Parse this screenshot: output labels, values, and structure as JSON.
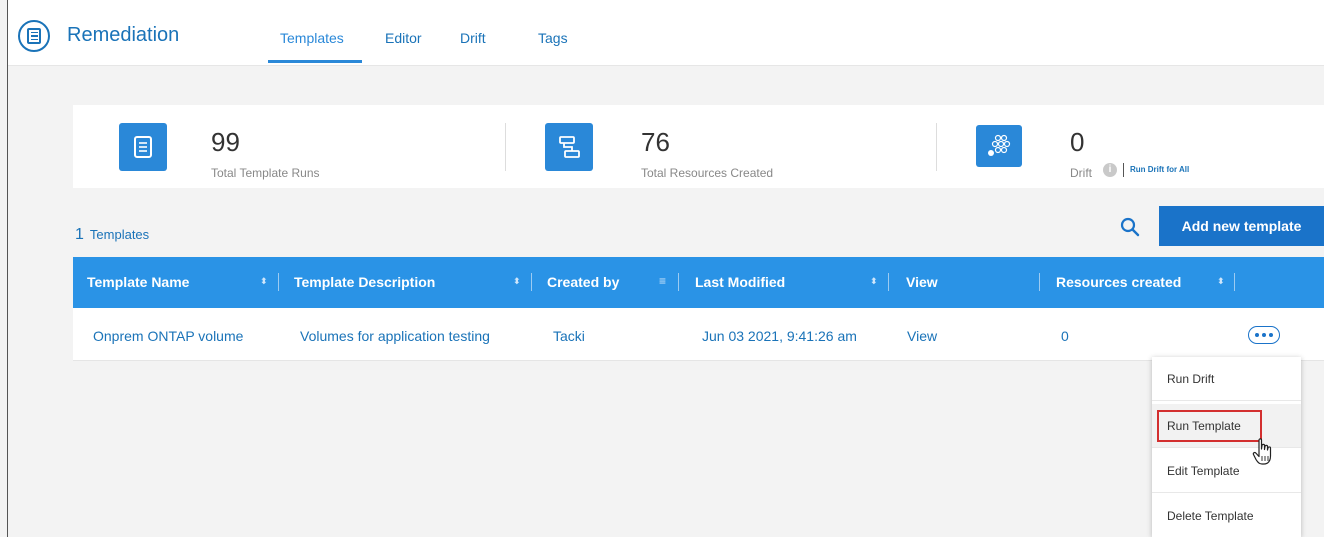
{
  "header": {
    "app_title": "Remediation",
    "tabs": [
      {
        "label": "Templates",
        "active": true
      },
      {
        "label": "Editor",
        "active": false
      },
      {
        "label": "Drift",
        "active": false
      },
      {
        "label": "Tags",
        "active": false
      }
    ],
    "app_icon": "document-circle-icon"
  },
  "stats": {
    "runs": {
      "value": "99",
      "label": "Total Template Runs",
      "icon": "document-icon"
    },
    "resources": {
      "value": "76",
      "label": "Total Resources Created",
      "icon": "hierarchy-icon"
    },
    "drift": {
      "value": "0",
      "label": "Drift",
      "icon": "dots-cluster-icon",
      "info_icon": "info-icon",
      "link": "Run Drift for All"
    }
  },
  "templates": {
    "count": "1",
    "label": "Templates",
    "add_button": "Add new template",
    "search_icon": "search-icon"
  },
  "table": {
    "columns": [
      "Template Name",
      "Template Description",
      "Created by",
      "Last Modified",
      "View",
      "Resources created"
    ],
    "rows": [
      {
        "name": "Onprem ONTAP volume",
        "description": "Volumes for application testing",
        "created_by": "Tacki",
        "last_modified": "Jun 03 2021, 9:41:26 am",
        "view": "View",
        "resources": "0"
      }
    ]
  },
  "menu": {
    "items": [
      "Run Drift",
      "Run Template",
      "Edit Template",
      "Delete Template"
    ],
    "highlighted": "Run Template"
  },
  "colors": {
    "accent": "#1a73b8",
    "header_blue": "#2a93e6",
    "button_blue": "#1a73c9",
    "highlight_red": "#d32f2f"
  }
}
